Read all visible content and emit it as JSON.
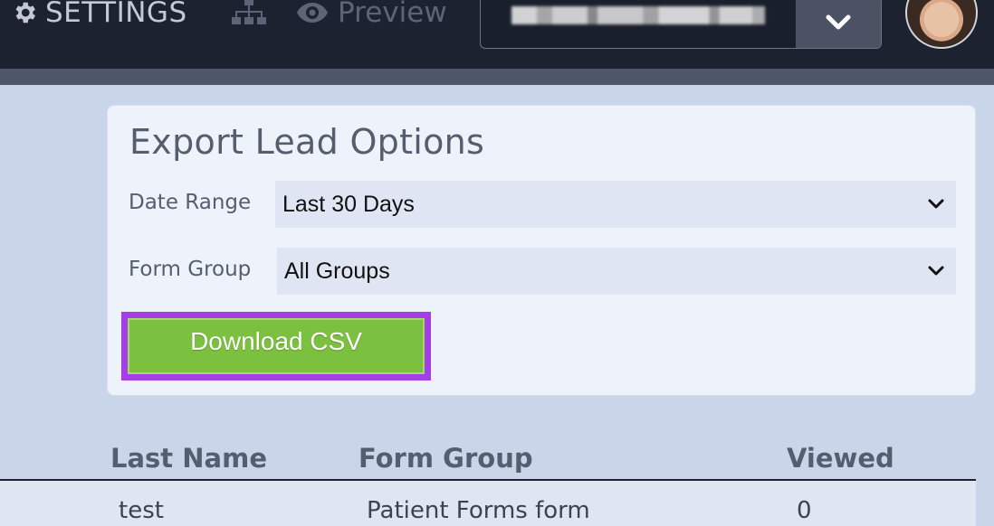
{
  "nav": {
    "settings_label": "SETTINGS",
    "preview_label": "Preview",
    "sitemap_icon": "sitemap-icon",
    "account_value": "",
    "icons": {
      "settings": "gear-icon",
      "preview": "eye-icon",
      "account_toggle": "chevron-down-icon",
      "avatar": "user-avatar"
    }
  },
  "export": {
    "title": "Export Lead Options",
    "date_range_label": "Date Range",
    "date_range_value": "Last 30 Days",
    "form_group_label": "Form Group",
    "form_group_value": "All Groups",
    "download_label": "Download CSV"
  },
  "table": {
    "columns": [
      "Last Name",
      "Form Group",
      "Viewed"
    ],
    "rows": [
      [
        "test",
        "Patient Forms form",
        "0"
      ]
    ]
  },
  "colors": {
    "topbar": "#1d2230",
    "page_bg": "#c9d5e8",
    "button_green": "#7cc040",
    "highlight_purple": "#a43fe8"
  }
}
